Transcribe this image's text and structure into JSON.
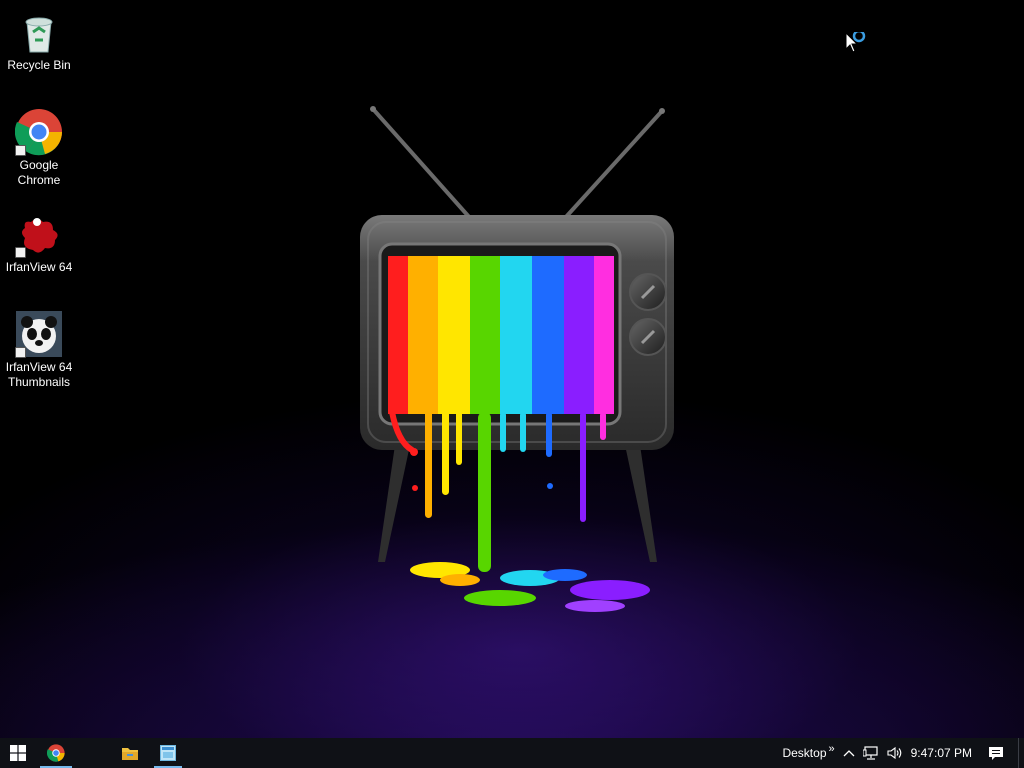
{
  "desktop": {
    "icons": [
      {
        "label": "Recycle Bin",
        "icon": "recycle-bin-icon"
      },
      {
        "label": "Google\nChrome",
        "icon": "chrome-icon"
      },
      {
        "label": "IrfanView 64",
        "icon": "irfanview-icon"
      },
      {
        "label": "IrfanView 64\nThumbnails",
        "icon": "irfanview-thumbnails-icon"
      }
    ],
    "wallpaper": "tv-rainbow-paint-drip"
  },
  "taskbar": {
    "start_icon": "windows-logo-icon",
    "pinned": [
      {
        "icon": "chrome-icon",
        "state": "running"
      },
      {
        "icon": "file-explorer-icon",
        "state": "idle"
      },
      {
        "icon": "irfanview-thumbnails-icon",
        "state": "running"
      }
    ],
    "toolbar_label": "Desktop",
    "toolbar_chevron": "»",
    "tray_icons": [
      "chevron-up-icon",
      "network-icon",
      "volume-icon"
    ],
    "clock": "9:47:07 PM",
    "action_center_icon": "action-center-icon"
  },
  "colors": {
    "taskbar_bg": "#0f1116",
    "accent": "#76b9ed"
  }
}
